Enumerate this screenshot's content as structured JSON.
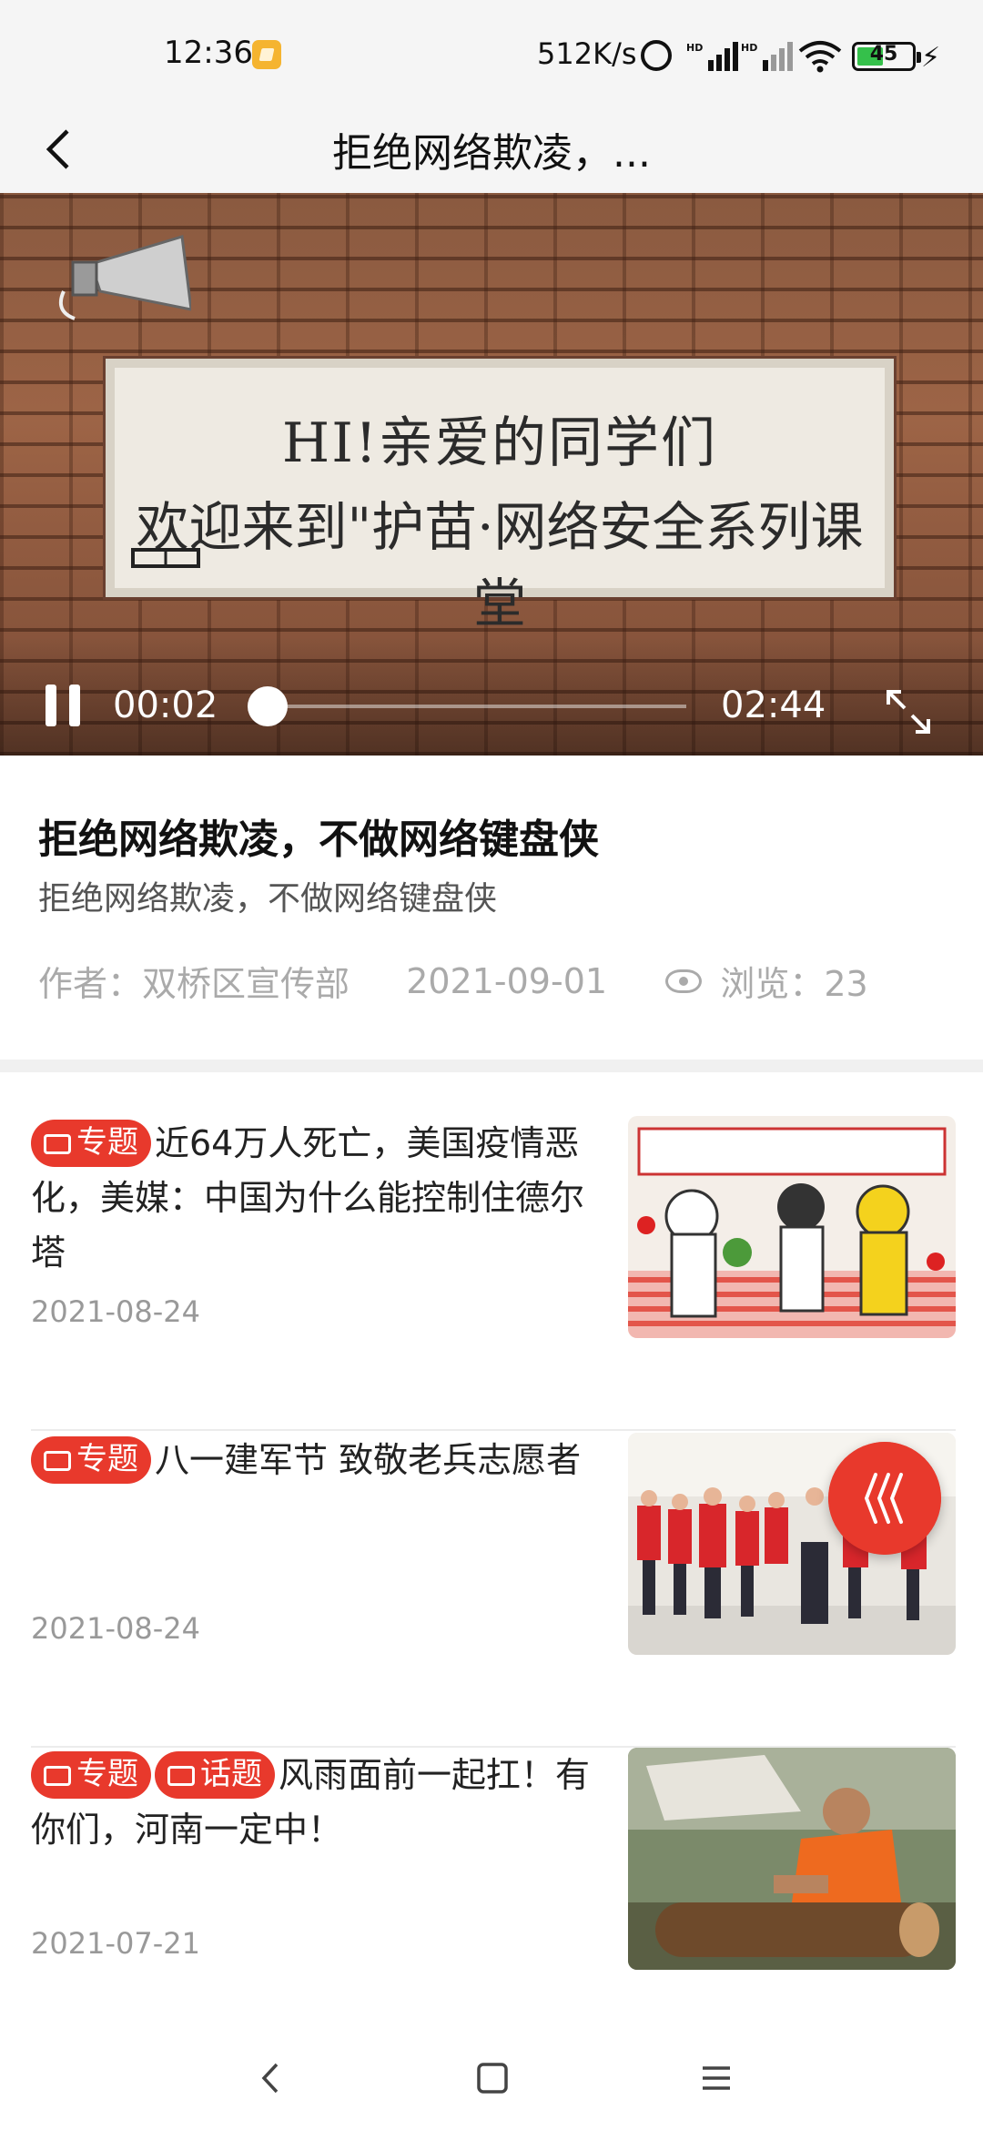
{
  "status_bar": {
    "time": "12:36",
    "net_speed": "512K/s",
    "battery": "45",
    "icons": [
      "notification-icon",
      "alarm-icon",
      "signal-hd-icon",
      "wifi-icon",
      "battery-icon",
      "charging-icon"
    ]
  },
  "header": {
    "title": "拒绝网络欺凌，..."
  },
  "video": {
    "board_line1": "HI!亲爱的同学们",
    "board_line2": "欢迎来到\"护苗·网络安全系列课堂",
    "current_time": "00:02",
    "duration": "02:44",
    "progress": 0.012
  },
  "article": {
    "title": "拒绝网络欺凌，不做网络键盘侠",
    "subtitle": "拒绝网络欺凌，不做网络键盘侠",
    "author": "作者：双桥区宣传部",
    "date": "2021-09-01",
    "views": "浏览：23"
  },
  "list": [
    {
      "tags": [
        "专题"
      ],
      "text": "近64万人死亡，美国疫情恶化，美媒：中国为什么能控制住德尔塔",
      "date": "2021-08-24"
    },
    {
      "tags": [
        "专题"
      ],
      "text": "八一建军节 致敬老兵志愿者",
      "date": "2021-08-24"
    },
    {
      "tags": [
        "专题",
        "话题"
      ],
      "text": "风雨面前一起扛！有你们，河南一定中！",
      "date": "2021-07-21"
    }
  ],
  "colors": {
    "accent": "#e8392c",
    "muted": "#999999",
    "text": "#222222"
  }
}
